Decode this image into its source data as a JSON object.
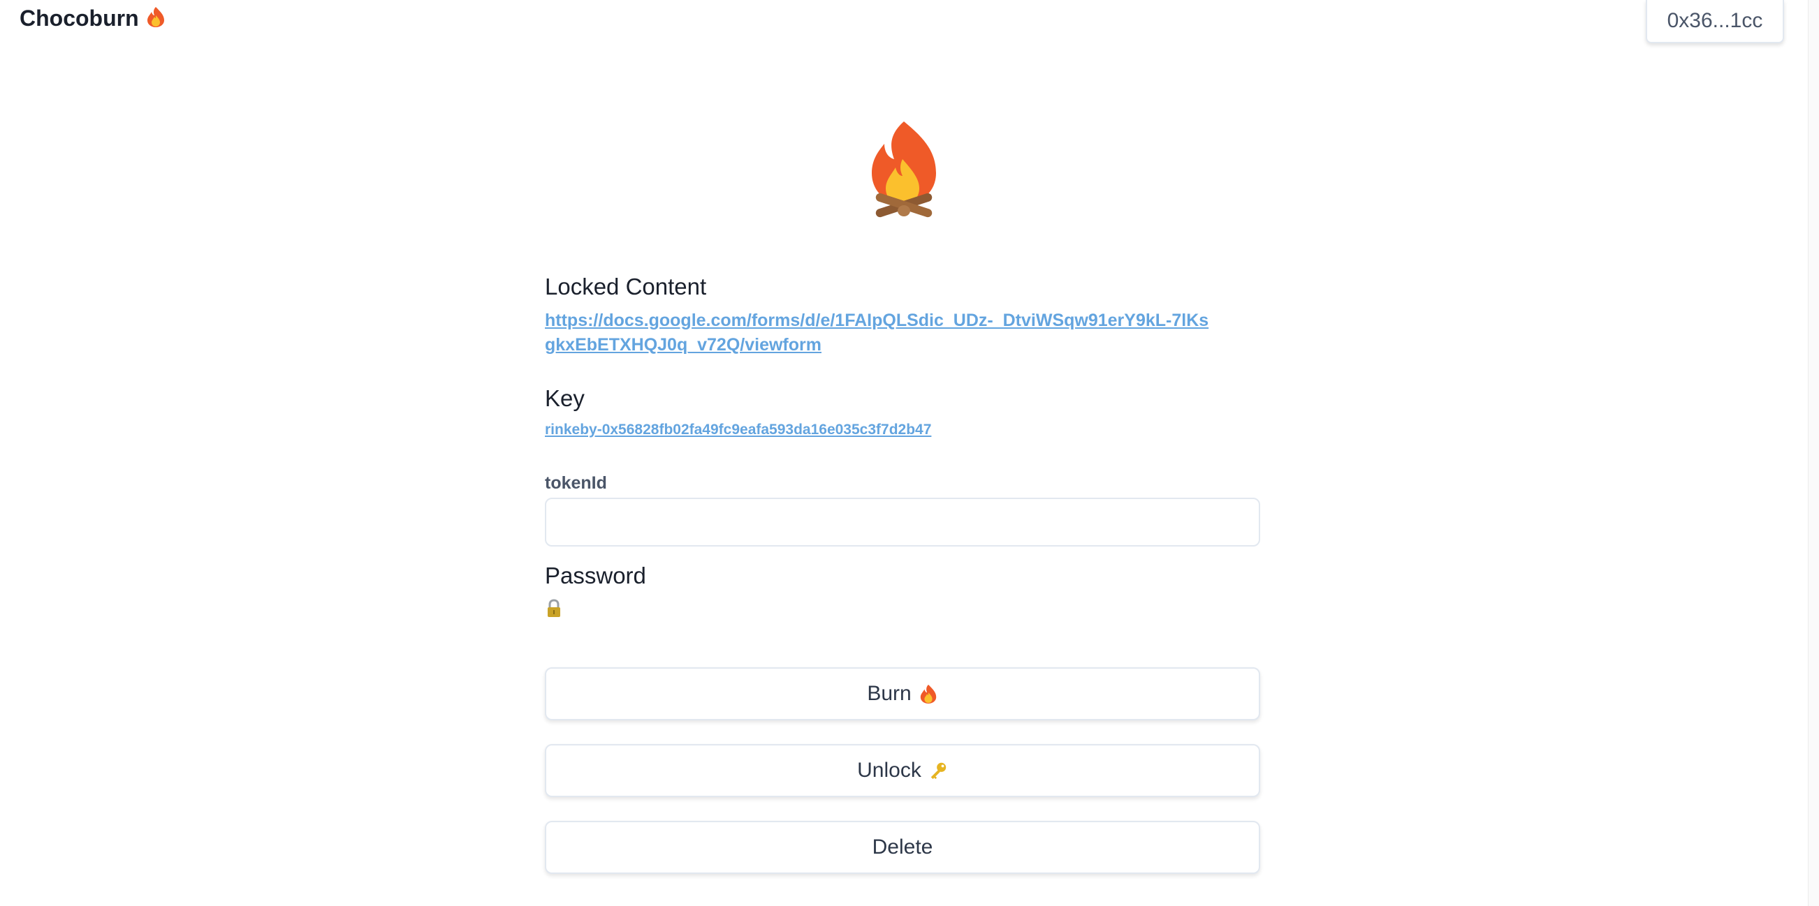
{
  "header": {
    "app_title": "Chocoburn",
    "app_title_icon": "fire-icon",
    "wallet_address": "0x36...1cc"
  },
  "hero": {
    "icon": "campfire-icon"
  },
  "locked_content": {
    "heading": "Locked Content",
    "url": "https://docs.google.com/forms/d/e/1FAIpQLSdic_UDz-_DtviWSqw91erY9kL-7lKsgkxEbETXHQJ0q_v72Q/viewform"
  },
  "key": {
    "heading": "Key",
    "value": "rinkeby-0x56828fb02fa49fc9eafa593da16e035c3f7d2b47"
  },
  "token": {
    "label": "tokenId",
    "value": "",
    "placeholder": ""
  },
  "password": {
    "heading": "Password",
    "icon": "lock-icon"
  },
  "actions": {
    "burn_label": "Burn",
    "burn_icon": "fire-icon",
    "unlock_label": "Unlock",
    "unlock_icon": "key-icon",
    "delete_label": "Delete"
  },
  "colors": {
    "link": "#63a4df",
    "border": "#e2e8f0",
    "text": "#1a202c",
    "muted_text": "#4a5568",
    "fire_outer": "#ef5a28",
    "fire_inner": "#fbc02d"
  }
}
